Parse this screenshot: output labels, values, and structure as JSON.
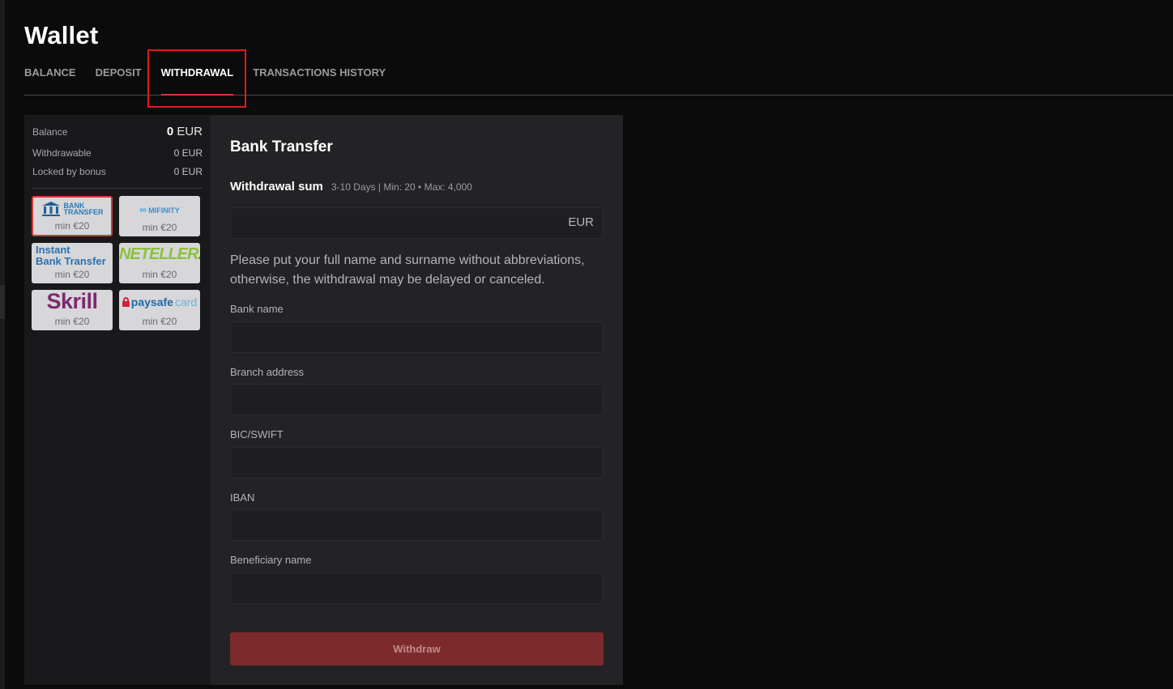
{
  "page": {
    "title": "Wallet"
  },
  "tabs": [
    {
      "label": "BALANCE",
      "active": false
    },
    {
      "label": "DEPOSIT",
      "active": false
    },
    {
      "label": "WITHDRAWAL",
      "active": true
    },
    {
      "label": "TRANSACTIONS HISTORY",
      "active": false
    }
  ],
  "balance": {
    "main_label": "Balance",
    "main_amount": "0",
    "main_currency": "EUR",
    "withdrawable_label": "Withdrawable",
    "withdrawable_value": "0 EUR",
    "locked_label": "Locked by bonus",
    "locked_value": "0 EUR"
  },
  "methods": [
    {
      "name": "Bank Transfer",
      "logo_line1": "BANK",
      "logo_line2": "TRANSFER",
      "min": "min €20",
      "selected": true
    },
    {
      "name": "MiFinity",
      "logo_text": "MIFINITY",
      "min": "min €20",
      "selected": false
    },
    {
      "name": "Instant Bank Transfer",
      "logo_line1": "Instant",
      "logo_line2": "Bank Transfer",
      "min": "min €20",
      "selected": false
    },
    {
      "name": "Neteller",
      "logo_text": "NETELLER",
      "logo_suffix": ".",
      "min": "min €20",
      "selected": false
    },
    {
      "name": "Skrill",
      "logo_text": "Skrill",
      "min": "min €20",
      "selected": false
    },
    {
      "name": "paysafecard",
      "logo_part1": "paysafe",
      "logo_part2": "card",
      "min": "min €20",
      "selected": false
    }
  ],
  "form": {
    "title": "Bank Transfer",
    "sum_label": "Withdrawal sum",
    "sum_info": "3-10 Days | Min: 20 • Max: 4,000",
    "sum_value": "",
    "currency": "EUR",
    "note": "Please put your full name and surname without abbreviations, otherwise, the withdrawal may be delayed or canceled.",
    "fields": [
      {
        "label": "Bank name",
        "value": ""
      },
      {
        "label": "Branch address",
        "value": ""
      },
      {
        "label": "BIC/SWIFT",
        "value": ""
      },
      {
        "label": "IBAN",
        "value": ""
      },
      {
        "label": "Beneficiary name",
        "value": ""
      }
    ],
    "submit_label": "Withdraw"
  },
  "colors": {
    "accent": "#d23a3a",
    "button": "#7d2a2c",
    "highlight_box": "#e01b1b"
  }
}
